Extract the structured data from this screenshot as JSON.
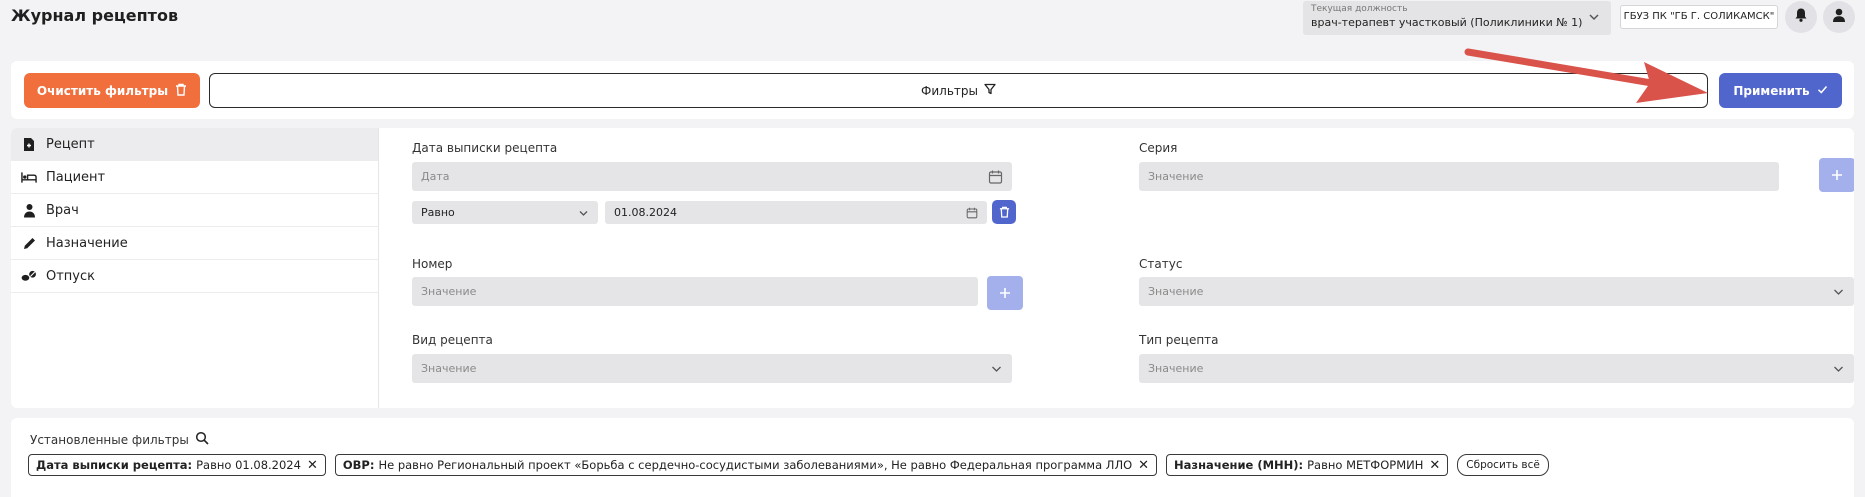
{
  "header": {
    "title": "Журнал рецептов",
    "position_caption": "Текущая должность",
    "position_value": "врач-терапевт участковый (Поликлиники № 1)",
    "organization": "ГБУЗ ПК \"ГБ Г. СОЛИКАМСК\""
  },
  "filter_bar": {
    "clear_label": "Очистить фильтры",
    "filters_label": "Фильтры",
    "apply_label": "Применить"
  },
  "sidebar": {
    "items": [
      {
        "label": "Рецепт",
        "icon": "document-icon",
        "active": true
      },
      {
        "label": "Пациент",
        "icon": "patient-bed-icon",
        "active": false
      },
      {
        "label": "Врач",
        "icon": "doctor-icon",
        "active": false
      },
      {
        "label": "Назначение",
        "icon": "pencil-icon",
        "active": false
      },
      {
        "label": "Отпуск",
        "icon": "pills-icon",
        "active": false
      }
    ]
  },
  "form": {
    "issue_date": {
      "label": "Дата выписки рецепта",
      "placeholder": "Дата",
      "operator": "Равно",
      "value": "01.08.2024"
    },
    "series": {
      "label": "Серия",
      "placeholder": "Значение"
    },
    "number": {
      "label": "Номер",
      "placeholder": "Значение"
    },
    "status": {
      "label": "Статус",
      "placeholder": "Значение"
    },
    "recipe_kind": {
      "label": "Вид рецепта",
      "placeholder": "Значение"
    },
    "recipe_type": {
      "label": "Тип рецепта",
      "placeholder": "Значение"
    }
  },
  "applied_filters": {
    "title": "Установленные фильтры",
    "chips": [
      {
        "name": "Дата выписки рецепта:",
        "value": "Равно 01.08.2024"
      },
      {
        "name": "ОВР:",
        "value": "Не равно Региональный проект «Борьба с сердечно-сосудистыми заболеваниями», Не равно Федеральная программа ЛЛО"
      },
      {
        "name": "Назначение (МНН):",
        "value": "Равно МЕТФОРМИН"
      }
    ],
    "reset_label": "Сбросить всё"
  },
  "colors": {
    "accent_orange": "#f06f3d",
    "accent_blue": "#5166cd",
    "accent_blue_light": "#a3b0ec",
    "annotation_red": "#d9534a"
  }
}
